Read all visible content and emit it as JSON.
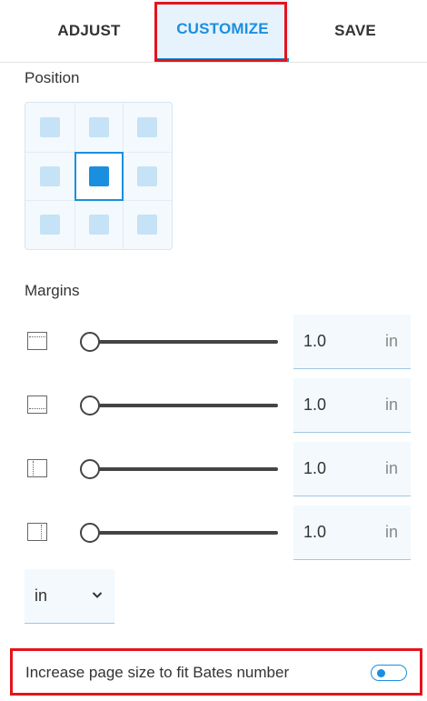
{
  "tabs": [
    {
      "label": "ADJUST",
      "active": false
    },
    {
      "label": "CUSTOMIZE",
      "active": true
    },
    {
      "label": "SAVE",
      "active": false
    }
  ],
  "position": {
    "label": "Position",
    "selected_cell": "middle-center"
  },
  "margins": {
    "label": "Margins",
    "rows": [
      {
        "icon": "top-margin-icon",
        "slider_value": 1.0,
        "value": "1.0",
        "unit": "in"
      },
      {
        "icon": "bottom-margin-icon",
        "slider_value": 1.0,
        "value": "1.0",
        "unit": "in"
      },
      {
        "icon": "left-margin-icon",
        "slider_value": 1.0,
        "value": "1.0",
        "unit": "in"
      },
      {
        "icon": "right-margin-icon",
        "slider_value": 1.0,
        "value": "1.0",
        "unit": "in"
      }
    ],
    "unit_select": {
      "value": "in"
    }
  },
  "fit_option": {
    "label": "Increase page size to fit Bates number",
    "enabled": false
  },
  "colors": {
    "accent": "#1a8fe0",
    "highlight": "#e3141b"
  }
}
